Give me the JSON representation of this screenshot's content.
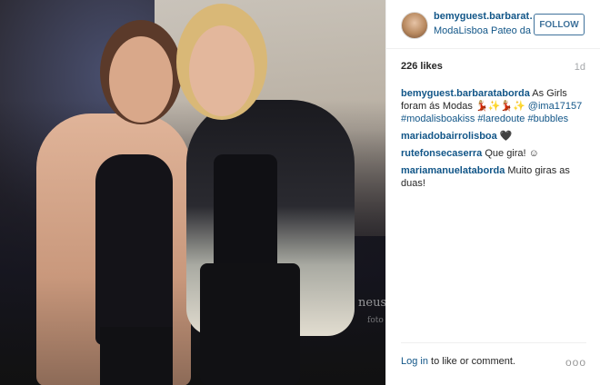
{
  "header": {
    "username": "bemyguest.barbarataborda",
    "location": "ModaLisboa Pateo da Galé",
    "follow_label": "FOLLOW"
  },
  "photo": {
    "watermark": "neus",
    "watermark_sub": "foto"
  },
  "stats": {
    "likes": "226 likes",
    "age": "1d"
  },
  "caption": {
    "user": "bemyguest.barbarataborda",
    "text_1": "As Girls foram ás Modas",
    "emoji": "💃🏼✨💃🏼✨",
    "mention": "@ima17157",
    "tags": [
      "#modalisboakiss",
      "#laredoute",
      "#bubbles"
    ]
  },
  "comments": [
    {
      "user": "mariadobairrolisboa",
      "text": "🖤"
    },
    {
      "user": "rutefonsecaserra",
      "text": "Que gira! ☺"
    },
    {
      "user": "mariamanuelataborda",
      "text": "Muito giras as duas!"
    }
  ],
  "footer": {
    "login_link": "Log in",
    "login_text": "to like or comment.",
    "more_label": "ooo"
  },
  "colors": {
    "link": "#125688",
    "follow_border": "#3f729b",
    "muted": "#a5a7aa"
  },
  "icons": [
    "avatar",
    "more-options-icon"
  ]
}
